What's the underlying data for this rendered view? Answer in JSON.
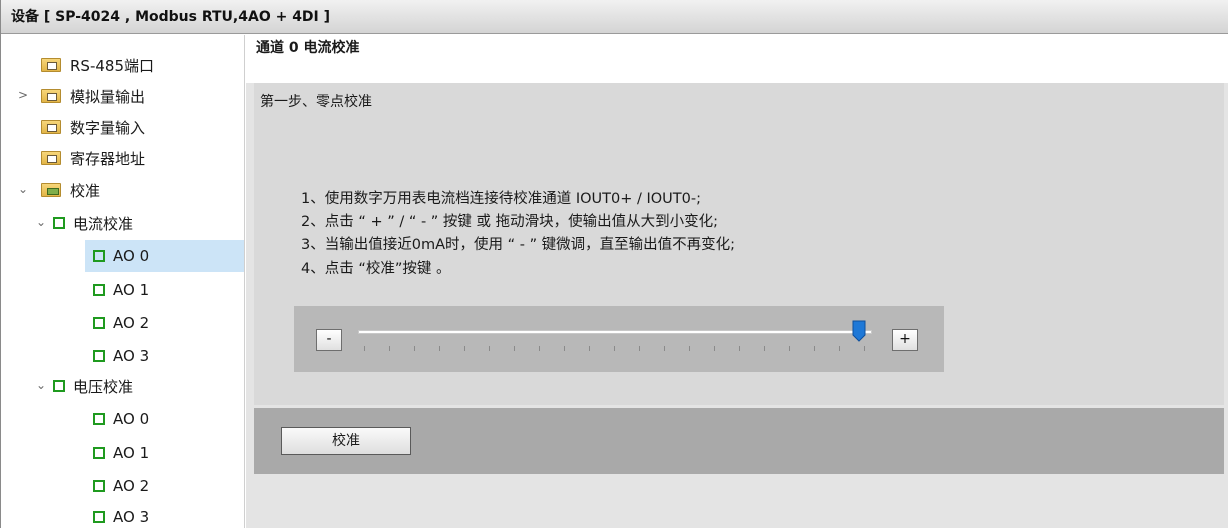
{
  "window": {
    "title": "设备  [ SP-4024 ,  Modbus RTU,4AO + 4DI ]"
  },
  "sidebar": {
    "items": [
      {
        "label": "RS-485端口"
      },
      {
        "label": "模拟量输出"
      },
      {
        "label": "数字量输入"
      },
      {
        "label": "寄存器地址"
      },
      {
        "label": "校准"
      },
      {
        "label": "电流校准"
      },
      {
        "label": "AO 0"
      },
      {
        "label": "AO 1"
      },
      {
        "label": "AO 2"
      },
      {
        "label": "AO 3"
      },
      {
        "label": "电压校准"
      },
      {
        "label": "AO 0"
      },
      {
        "label": "AO 1"
      },
      {
        "label": "AO 2"
      },
      {
        "label": "AO 3"
      }
    ],
    "selected_index": 6
  },
  "main": {
    "channel_title": "通道 0 电流校准",
    "step_title": "第一步、零点校准",
    "instructions": [
      "1、使用数字万用表电流档连接待校准通道 IOUT0+ / IOUT0-;",
      "2、点击 “ + ” / “ - ”  按键 或 拖动滑块，使输出值从大到小变化;",
      "3、当输出值接近0mA时，使用 “ - ”  键微调，直至输出值不再变化;",
      "4、点击 “校准”按键 。"
    ],
    "slider": {
      "minus_label": "-",
      "plus_label": "+",
      "value_fraction": 0.99
    },
    "calibrate_button": "校准"
  },
  "colors": {
    "selection": "#cce4f7",
    "green_node": "#1f9a1f",
    "thumb": "#1e78d7"
  }
}
